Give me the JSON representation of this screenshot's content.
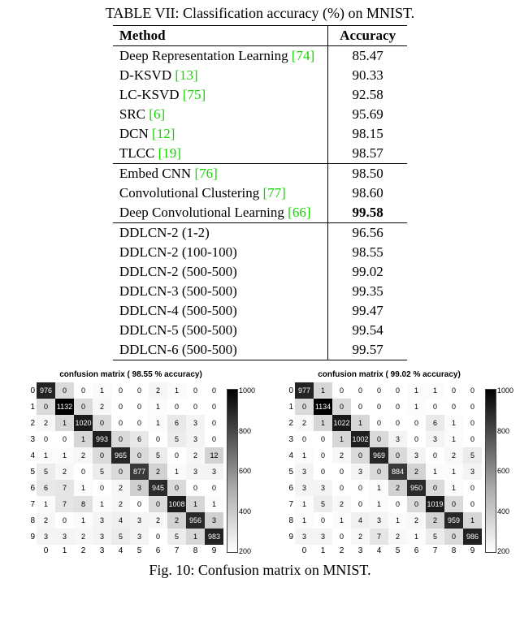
{
  "table": {
    "caption": "TABLE VII: Classification accuracy (%) on MNIST.",
    "head": {
      "method": "Method",
      "accuracy": "Accuracy"
    },
    "groups": [
      [
        {
          "method": "Deep Representation Learning ",
          "cite": "[74]",
          "accuracy": "85.47"
        },
        {
          "method": "D-KSVD ",
          "cite": "[13]",
          "accuracy": "90.33"
        },
        {
          "method": "LC-KSVD ",
          "cite": "[75]",
          "accuracy": "92.58"
        },
        {
          "method": "SRC ",
          "cite": "[6]",
          "accuracy": "95.69"
        },
        {
          "method": "DCN ",
          "cite": "[12]",
          "accuracy": "98.15"
        },
        {
          "method": "TLCC ",
          "cite": "[19]",
          "accuracy": "98.57"
        }
      ],
      [
        {
          "method": "Embed CNN ",
          "cite": "[76]",
          "accuracy": "98.50"
        },
        {
          "method": "Convolutional Clustering ",
          "cite": "[77]",
          "accuracy": "98.60"
        },
        {
          "method": "Deep Convolutional Learning ",
          "cite": "[66]",
          "accuracy": "99.58",
          "bold_acc": true
        }
      ],
      [
        {
          "method": "DDLCN-2 (1-2)",
          "cite": "",
          "accuracy": "96.56"
        },
        {
          "method": "DDLCN-2 (100-100)",
          "cite": "",
          "accuracy": "98.55"
        },
        {
          "method": "DDLCN-2 (500-500)",
          "cite": "",
          "accuracy": "99.02"
        },
        {
          "method": "DDLCN-3 (500-500)",
          "cite": "",
          "accuracy": "99.35"
        },
        {
          "method": "DDLCN-4 (500-500)",
          "cite": "",
          "accuracy": "99.47"
        },
        {
          "method": "DDLCN-5 (500-500)",
          "cite": "",
          "accuracy": "99.54"
        },
        {
          "method": "DDLCN-6 (500-500)",
          "cite": "",
          "accuracy": "99.57"
        }
      ]
    ]
  },
  "figure": {
    "caption": "Fig. 10: Confusion matrix on MNIST.",
    "labels": [
      "0",
      "1",
      "2",
      "3",
      "4",
      "5",
      "6",
      "7",
      "8",
      "9"
    ],
    "colorbar_ticks": [
      "1000",
      "800",
      "600",
      "400",
      "200"
    ],
    "matrices": [
      {
        "title": "confusion matrix ( 98.55 % accuracy)",
        "data": [
          [
            976,
            0,
            0,
            1,
            0,
            0,
            2,
            1,
            0,
            0
          ],
          [
            0,
            1132,
            0,
            2,
            0,
            0,
            1,
            0,
            0,
            0
          ],
          [
            2,
            1,
            1020,
            0,
            0,
            0,
            1,
            6,
            3,
            0
          ],
          [
            0,
            0,
            1,
            993,
            0,
            6,
            0,
            5,
            3,
            0
          ],
          [
            1,
            1,
            2,
            0,
            965,
            0,
            5,
            0,
            2,
            12
          ],
          [
            5,
            2,
            0,
            5,
            0,
            877,
            2,
            1,
            3,
            3
          ],
          [
            6,
            7,
            1,
            0,
            2,
            3,
            945,
            0,
            0,
            0
          ],
          [
            1,
            7,
            8,
            1,
            2,
            0,
            0,
            1008,
            1,
            1
          ],
          [
            2,
            0,
            1,
            3,
            4,
            3,
            2,
            2,
            956,
            3
          ],
          [
            3,
            3,
            2,
            3,
            5,
            3,
            0,
            5,
            1,
            983
          ]
        ]
      },
      {
        "title": "confusion matrix ( 99.02 % accuracy)",
        "data": [
          [
            977,
            1,
            0,
            0,
            0,
            0,
            1,
            1,
            0,
            0
          ],
          [
            0,
            1134,
            0,
            0,
            0,
            0,
            1,
            0,
            0,
            0
          ],
          [
            2,
            1,
            1022,
            1,
            0,
            0,
            0,
            6,
            1,
            0
          ],
          [
            0,
            0,
            1,
            1002,
            0,
            3,
            0,
            3,
            1,
            0
          ],
          [
            1,
            0,
            2,
            0,
            969,
            0,
            3,
            0,
            2,
            5
          ],
          [
            3,
            0,
            0,
            3,
            0,
            884,
            2,
            1,
            1,
            3
          ],
          [
            3,
            3,
            0,
            0,
            1,
            2,
            950,
            0,
            1,
            0
          ],
          [
            1,
            5,
            2,
            0,
            1,
            0,
            0,
            1019,
            0,
            0
          ],
          [
            1,
            0,
            1,
            4,
            3,
            1,
            2,
            2,
            959,
            1
          ],
          [
            3,
            3,
            0,
            2,
            7,
            2,
            1,
            5,
            0,
            986
          ]
        ]
      }
    ]
  },
  "chart_data": [
    {
      "type": "heatmap",
      "title": "confusion matrix ( 98.55 % accuracy)",
      "xlabel": "",
      "ylabel": "",
      "x_ticks": [
        "0",
        "1",
        "2",
        "3",
        "4",
        "5",
        "6",
        "7",
        "8",
        "9"
      ],
      "y_ticks": [
        "0",
        "1",
        "2",
        "3",
        "4",
        "5",
        "6",
        "7",
        "8",
        "9"
      ],
      "colorbar_range": [
        0,
        1132
      ],
      "values": [
        [
          976,
          0,
          0,
          1,
          0,
          0,
          2,
          1,
          0,
          0
        ],
        [
          0,
          1132,
          0,
          2,
          0,
          0,
          1,
          0,
          0,
          0
        ],
        [
          2,
          1,
          1020,
          0,
          0,
          0,
          1,
          6,
          3,
          0
        ],
        [
          0,
          0,
          1,
          993,
          0,
          6,
          0,
          5,
          3,
          0
        ],
        [
          1,
          1,
          2,
          0,
          965,
          0,
          5,
          0,
          2,
          12
        ],
        [
          5,
          2,
          0,
          5,
          0,
          877,
          2,
          1,
          3,
          3
        ],
        [
          6,
          7,
          1,
          0,
          2,
          3,
          945,
          0,
          0,
          0
        ],
        [
          1,
          7,
          8,
          1,
          2,
          0,
          0,
          1008,
          1,
          1
        ],
        [
          2,
          0,
          1,
          3,
          4,
          3,
          2,
          2,
          956,
          3
        ],
        [
          3,
          3,
          2,
          3,
          5,
          3,
          0,
          5,
          1,
          983
        ]
      ]
    },
    {
      "type": "heatmap",
      "title": "confusion matrix ( 99.02 % accuracy)",
      "xlabel": "",
      "ylabel": "",
      "x_ticks": [
        "0",
        "1",
        "2",
        "3",
        "4",
        "5",
        "6",
        "7",
        "8",
        "9"
      ],
      "y_ticks": [
        "0",
        "1",
        "2",
        "3",
        "4",
        "5",
        "6",
        "7",
        "8",
        "9"
      ],
      "colorbar_range": [
        0,
        1134
      ],
      "values": [
        [
          977,
          1,
          0,
          0,
          0,
          0,
          1,
          1,
          0,
          0
        ],
        [
          0,
          1134,
          0,
          0,
          0,
          0,
          1,
          0,
          0,
          0
        ],
        [
          2,
          1,
          1022,
          1,
          0,
          0,
          0,
          6,
          1,
          0
        ],
        [
          0,
          0,
          1,
          1002,
          0,
          3,
          0,
          3,
          1,
          0
        ],
        [
          1,
          0,
          2,
          0,
          969,
          0,
          3,
          0,
          2,
          5
        ],
        [
          3,
          0,
          0,
          3,
          0,
          884,
          2,
          1,
          1,
          3
        ],
        [
          3,
          3,
          0,
          0,
          1,
          2,
          950,
          0,
          1,
          0
        ],
        [
          1,
          5,
          2,
          0,
          1,
          0,
          0,
          1019,
          0,
          0
        ],
        [
          1,
          0,
          1,
          4,
          3,
          1,
          2,
          2,
          959,
          1
        ],
        [
          3,
          3,
          0,
          2,
          7,
          2,
          1,
          5,
          0,
          986
        ]
      ]
    },
    {
      "type": "table",
      "title": "TABLE VII: Classification accuracy (%) on MNIST.",
      "columns": [
        "Method",
        "Accuracy"
      ],
      "rows": [
        [
          "Deep Representation Learning [74]",
          85.47
        ],
        [
          "D-KSVD [13]",
          90.33
        ],
        [
          "LC-KSVD [75]",
          92.58
        ],
        [
          "SRC [6]",
          95.69
        ],
        [
          "DCN [12]",
          98.15
        ],
        [
          "TLCC [19]",
          98.57
        ],
        [
          "Embed CNN [76]",
          98.5
        ],
        [
          "Convolutional Clustering [77]",
          98.6
        ],
        [
          "Deep Convolutional Learning [66]",
          99.58
        ],
        [
          "DDLCN-2 (1-2)",
          96.56
        ],
        [
          "DDLCN-2 (100-100)",
          98.55
        ],
        [
          "DDLCN-2 (500-500)",
          99.02
        ],
        [
          "DDLCN-3 (500-500)",
          99.35
        ],
        [
          "DDLCN-4 (500-500)",
          99.47
        ],
        [
          "DDLCN-5 (500-500)",
          99.54
        ],
        [
          "DDLCN-6 (500-500)",
          99.57
        ]
      ]
    }
  ]
}
